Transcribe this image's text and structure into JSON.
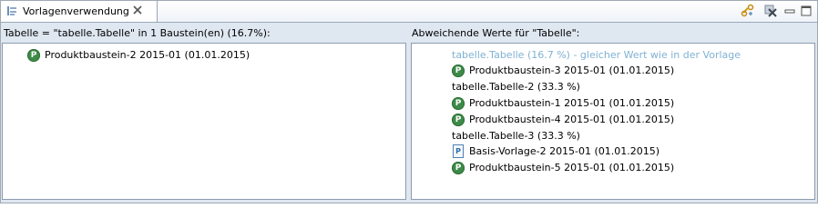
{
  "view": {
    "tab_title": "Vorlagenverwendung",
    "tab_icon": "template-usage-icon",
    "toolbar": [
      {
        "name": "link-with-editor-icon",
        "interactable": true
      },
      {
        "name": "clear-icon",
        "interactable": true
      },
      {
        "name": "minimize-icon",
        "interactable": true
      },
      {
        "name": "maximize-icon",
        "interactable": true
      }
    ]
  },
  "left_pane": {
    "label": "Tabelle = \"tabelle.Tabelle\" in 1 Baustein(en) (16.7%):",
    "items": [
      {
        "text": "Produktbaustein-2 2015-01 (01.01.2015)",
        "icon": "product-icon"
      }
    ]
  },
  "right_pane": {
    "label": "Abweichende Werte für \"Tabelle\":",
    "items": [
      {
        "text": "tabelle.Tabelle (16.7 %) - gleicher Wert wie in der Vorlage",
        "type": "group",
        "style": "dimmed"
      },
      {
        "text": "Produktbaustein-3 2015-01 (01.01.2015)",
        "icon": "product-icon"
      },
      {
        "text": "tabelle.Tabelle-2 (33.3 %)",
        "type": "group"
      },
      {
        "text": "Produktbaustein-1 2015-01 (01.01.2015)",
        "icon": "product-icon"
      },
      {
        "text": "Produktbaustein-4 2015-01 (01.01.2015)",
        "icon": "product-icon"
      },
      {
        "text": "tabelle.Tabelle-3 (33.3 %)",
        "type": "group"
      },
      {
        "text": "Basis-Vorlage-2 2015-01 (01.01.2015)",
        "icon": "template-document-icon"
      },
      {
        "text": "Produktbaustein-5 2015-01 (01.01.2015)",
        "icon": "product-icon"
      }
    ]
  },
  "colors": {
    "dimmed_text": "#7fb2d3",
    "product_icon": "#3e8a48",
    "background": "#dfe7f1"
  }
}
